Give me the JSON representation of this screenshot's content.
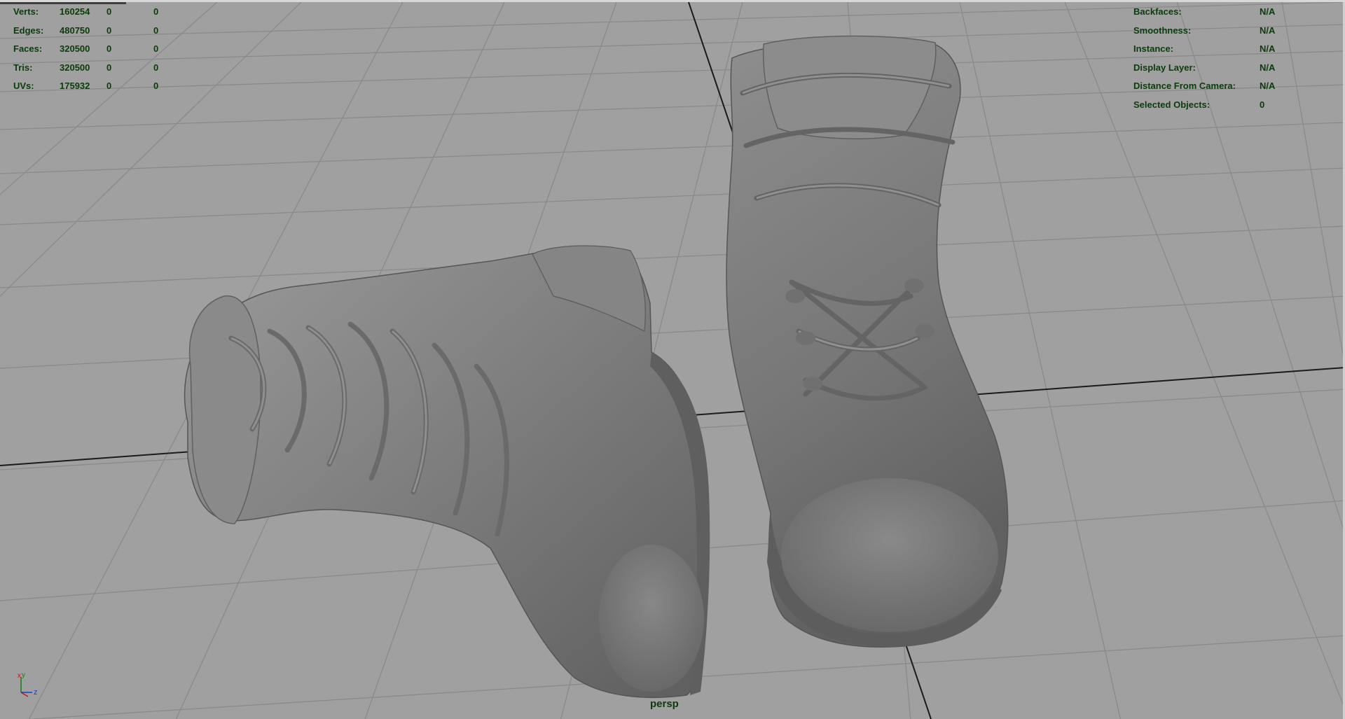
{
  "viewport": {
    "camera": "persp",
    "axis_labels": {
      "x": "x",
      "y": "y",
      "z": "z"
    }
  },
  "heads_up_left": {
    "rows": [
      {
        "label": "Verts:",
        "total": "160254",
        "selected": "0",
        "component": "0"
      },
      {
        "label": "Edges:",
        "total": "480750",
        "selected": "0",
        "component": "0"
      },
      {
        "label": "Faces:",
        "total": "320500",
        "selected": "0",
        "component": "0"
      },
      {
        "label": "Tris:",
        "total": "320500",
        "selected": "0",
        "component": "0"
      },
      {
        "label": "UVs:",
        "total": "175932",
        "selected": "0",
        "component": "0"
      }
    ]
  },
  "heads_up_right": {
    "rows": [
      {
        "label": "Backfaces:",
        "value": "N/A"
      },
      {
        "label": "Smoothness:",
        "value": "N/A"
      },
      {
        "label": "Instance:",
        "value": "N/A"
      },
      {
        "label": "Display Layer:",
        "value": "N/A"
      },
      {
        "label": "Distance From Camera:",
        "value": "N/A"
      },
      {
        "label": "Selected Objects:",
        "value": "0"
      }
    ]
  },
  "colors": {
    "viewport_background": "#a0a0a0",
    "grid_line": "#8a8a8a",
    "axis_line": "#1a1a1a",
    "hud_text": "#0b3b0b",
    "mesh_shade": "#7a7a7a"
  }
}
